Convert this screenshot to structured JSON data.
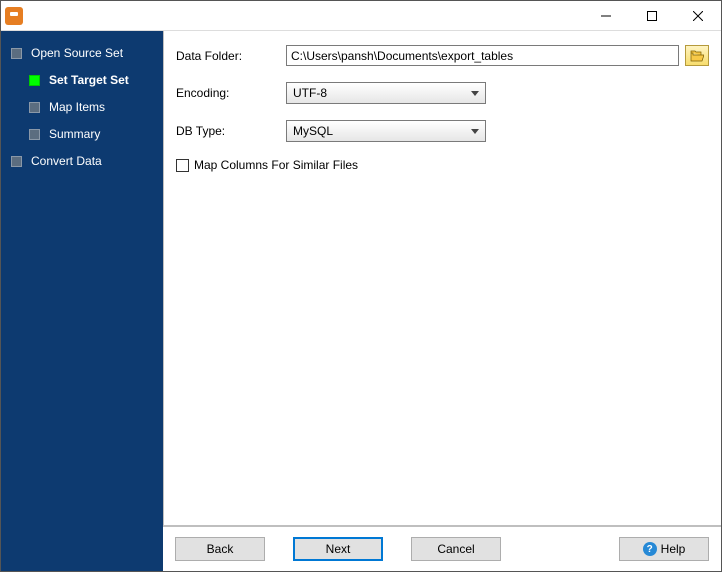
{
  "window": {
    "title": ""
  },
  "sidebar": {
    "items": [
      {
        "label": "Open Source Set",
        "level": 0,
        "active": false
      },
      {
        "label": "Set Target Set",
        "level": 1,
        "active": true
      },
      {
        "label": "Map Items",
        "level": 1,
        "active": false
      },
      {
        "label": "Summary",
        "level": 1,
        "active": false
      },
      {
        "label": "Convert Data",
        "level": 0,
        "active": false
      }
    ]
  },
  "form": {
    "dataFolder": {
      "label": "Data Folder:",
      "value": "C:\\Users\\pansh\\Documents\\export_tables"
    },
    "encoding": {
      "label": "Encoding:",
      "value": "UTF-8"
    },
    "dbType": {
      "label": "DB Type:",
      "value": "MySQL"
    },
    "mapColumns": {
      "label": "Map Columns For Similar Files",
      "checked": false
    }
  },
  "footer": {
    "back": "Back",
    "next": "Next",
    "cancel": "Cancel",
    "help": "Help"
  }
}
